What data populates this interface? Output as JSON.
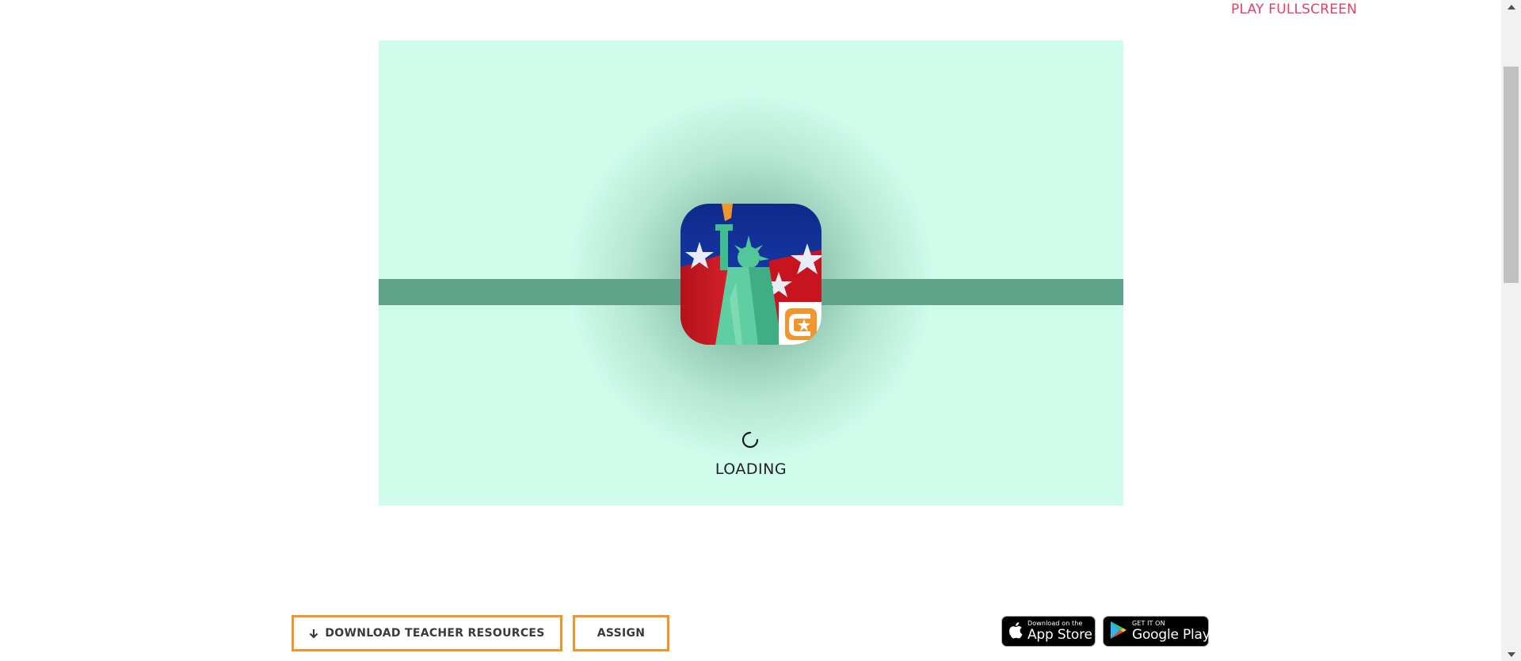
{
  "header": {
    "play_fullscreen_label": "PLAY FULLSCREEN"
  },
  "game": {
    "loading_label": "LOADING",
    "colors": {
      "background": "#d0fcec",
      "progress_track": "#5ea38a"
    },
    "icon": "statue-of-liberty-app-icon"
  },
  "actions": {
    "download_label": "DOWNLOAD TEACHER RESOURCES",
    "assign_label": "ASSIGN",
    "accent_color": "#f0962a"
  },
  "stores": {
    "apple_small": "Download on the",
    "apple_big": "App Store",
    "google_small": "GET IT ON",
    "google_big": "Google Play"
  }
}
